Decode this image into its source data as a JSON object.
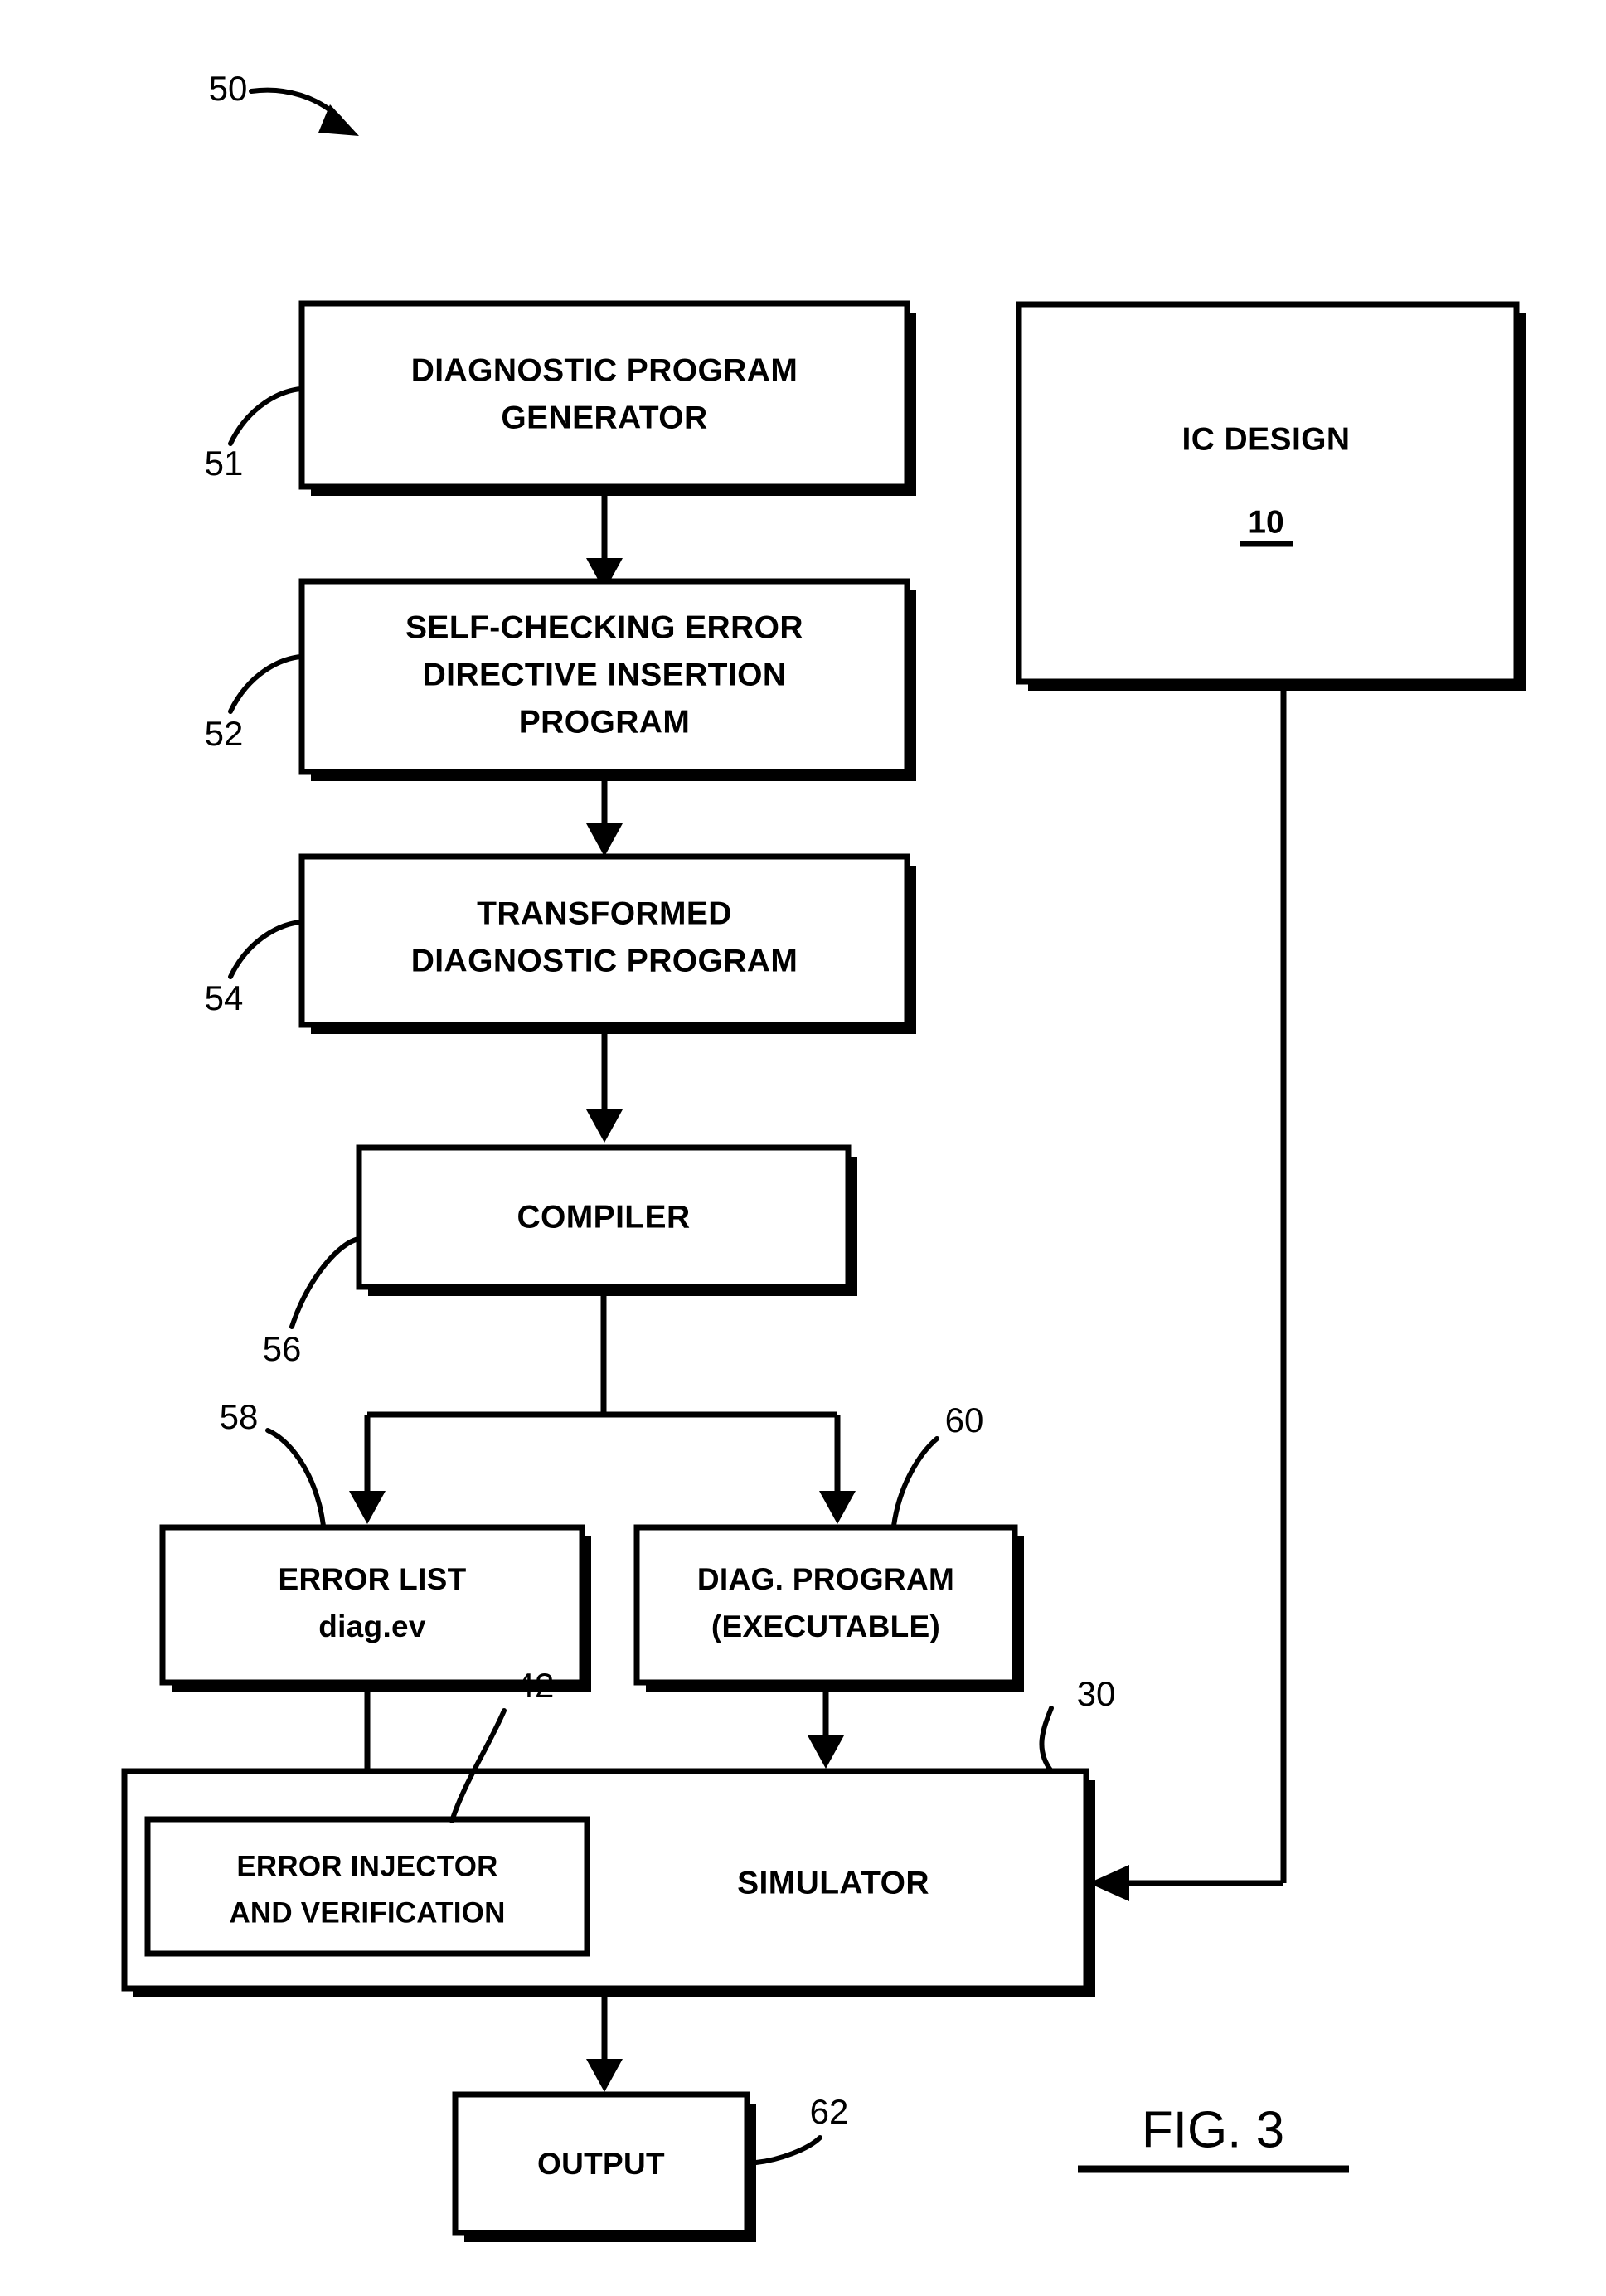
{
  "figure": {
    "label": "FIG. 3",
    "system_ref": "50"
  },
  "boxes": [
    {
      "id": "diagnostic-program-generator",
      "ref": "51",
      "lines": [
        "DIAGNOSTIC PROGRAM",
        "GENERATOR"
      ]
    },
    {
      "id": "self-checking-error-directive-insertion-program",
      "ref": "52",
      "lines": [
        "SELF-CHECKING ERROR",
        "DIRECTIVE INSERTION",
        "PROGRAM"
      ]
    },
    {
      "id": "transformed-diagnostic-program",
      "ref": "54",
      "lines": [
        "TRANSFORMED",
        "DIAGNOSTIC PROGRAM"
      ]
    },
    {
      "id": "compiler",
      "ref": "56",
      "lines": [
        "COMPILER"
      ]
    },
    {
      "id": "error-list",
      "ref": "58",
      "lines": [
        "ERROR LIST",
        "diag.ev"
      ]
    },
    {
      "id": "diag-program-executable",
      "ref": "60",
      "lines": [
        "DIAG. PROGRAM",
        "(EXECUTABLE)"
      ]
    },
    {
      "id": "simulator",
      "ref": "30",
      "lines": [
        "SIMULATOR"
      ]
    },
    {
      "id": "error-injector-and-verification",
      "ref": "42",
      "lines": [
        "ERROR INJECTOR",
        "AND VERIFICATION"
      ]
    },
    {
      "id": "output",
      "ref": "62",
      "lines": [
        "OUTPUT"
      ]
    },
    {
      "id": "ic-design",
      "ref": "10",
      "lines": [
        "IC DESIGN"
      ]
    }
  ],
  "text": {
    "dpg_line1": "DIAGNOSTIC PROGRAM",
    "dpg_line2": "GENERATOR",
    "scedip_line1": "SELF-CHECKING ERROR",
    "scedip_line2": "DIRECTIVE INSERTION",
    "scedip_line3": "PROGRAM",
    "tdp_line1": "TRANSFORMED",
    "tdp_line2": "DIAGNOSTIC PROGRAM",
    "compiler_line1": "COMPILER",
    "errorlist_line1": "ERROR LIST",
    "errorlist_line2": "diag.ev",
    "diagprog_line1": "DIAG. PROGRAM",
    "diagprog_line2": "(EXECUTABLE)",
    "simulator_line1": "SIMULATOR",
    "injector_line1": "ERROR INJECTOR",
    "injector_line2": "AND VERIFICATION",
    "output_line1": "OUTPUT",
    "icdesign_line1": "IC DESIGN",
    "icdesign_ref": "10"
  },
  "refs": {
    "system": "50",
    "dpg": "51",
    "scedip": "52",
    "tdp": "54",
    "compiler": "56",
    "errorlist": "58",
    "diagprog": "60",
    "simulator": "30",
    "injector": "42",
    "output": "62"
  },
  "colors": {
    "ink": "#000000",
    "paper": "#ffffff"
  }
}
